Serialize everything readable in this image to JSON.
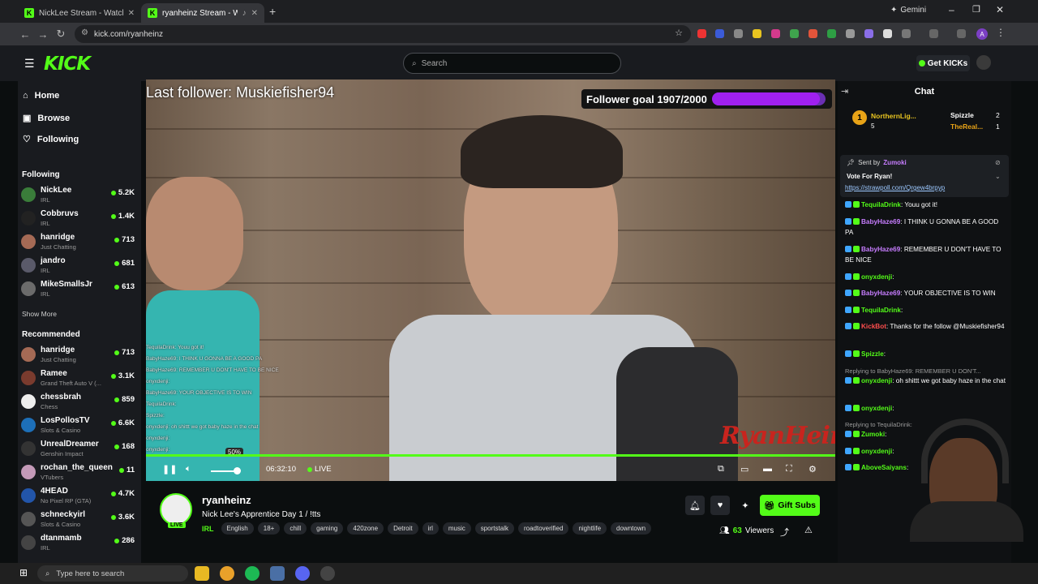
{
  "browser": {
    "tabs": [
      {
        "title": "NickLee Stream - Watch Live on",
        "active": false
      },
      {
        "title": "ryanheinz Stream - Watch L",
        "active": true
      }
    ],
    "url": "kick.com/ryanheinz",
    "gemini_label": "Gemini",
    "profile_initial": "A"
  },
  "topnav": {
    "logo": "KICK",
    "search_placeholder": "Search",
    "get_kicks": "Get KICKs"
  },
  "sidebar": {
    "nav": [
      {
        "label": "Home",
        "icon": "home-icon"
      },
      {
        "label": "Browse",
        "icon": "compass-icon"
      },
      {
        "label": "Following",
        "icon": "heart-icon"
      }
    ],
    "following_title": "Following",
    "following": [
      {
        "name": "NickLee",
        "category": "IRL",
        "viewers": "5.2K",
        "color": "#3a7d3a"
      },
      {
        "name": "Cobbruvs",
        "category": "IRL",
        "viewers": "1.4K",
        "color": "#222"
      },
      {
        "name": "hanridge",
        "category": "Just Chatting",
        "viewers": "713",
        "color": "#a56a55"
      },
      {
        "name": "jandro",
        "category": "IRL",
        "viewers": "681",
        "color": "#5a5a6a"
      },
      {
        "name": "MikeSmallsJr",
        "category": "IRL",
        "viewers": "613",
        "color": "#6b6b6b"
      }
    ],
    "show_more": "Show More",
    "recommended_title": "Recommended",
    "recommended": [
      {
        "name": "hanridge",
        "category": "Just Chatting",
        "viewers": "713",
        "color": "#a56a55"
      },
      {
        "name": "Ramee",
        "category": "Grand Theft Auto V (...",
        "viewers": "3.1K",
        "color": "#7a3b2e"
      },
      {
        "name": "chessbrah",
        "category": "Chess",
        "viewers": "859",
        "color": "#eee"
      },
      {
        "name": "LosPollosTV",
        "category": "Slots & Casino",
        "viewers": "6.6K",
        "color": "#1d6fb8"
      },
      {
        "name": "UnrealDreamer",
        "category": "Genshin Impact",
        "viewers": "168",
        "color": "#333"
      },
      {
        "name": "rochan_the_queen",
        "category": "VTubers",
        "viewers": "11",
        "color": "#c49ab8"
      },
      {
        "name": "4HEAD",
        "category": "No Pixel RP (GTA)",
        "viewers": "4.7K",
        "color": "#2255aa"
      },
      {
        "name": "schneckyirl",
        "category": "Slots & Casino",
        "viewers": "3.6K",
        "color": "#555"
      },
      {
        "name": "dtanmamb",
        "category": "IRL",
        "viewers": "286",
        "color": "#444"
      }
    ]
  },
  "video": {
    "last_follower": "Last follower: Muskiefisher94",
    "follower_goal_label": "Follower goal 1907/2000",
    "follower_goal_fraction": 0.9535,
    "overlay_chat": [
      "TequilaDrink: Youu got it!",
      "BabyHaze69: I THINK U GONNA BE A GOOD PA",
      "BabyHaze69: REMEMBER U DON'T HAVE TO BE NICE",
      "onyxdenji:",
      "BabyHaze69: YOUR OBJECTIVE IS TO WIN",
      "TequilaDrink:",
      "Spizzle:",
      "onyxdenji: oh shittt we got baby haze in the chat",
      "onyxdenji:",
      "onyxdenji:"
    ],
    "volume_tooltip": "50%",
    "volume_fraction": 0.5,
    "time": "06:32:10",
    "live_label": "LIVE",
    "watermark": "RyanHeinz"
  },
  "stream": {
    "streamer": "ryanheinz",
    "title": "Nick Lee's Apprentice Day 1 / !tts",
    "live_badge": "LIVE",
    "category": "IRL",
    "tags": [
      "English",
      "18+",
      "chill",
      "gaming",
      "420zone",
      "Detroit",
      "irl",
      "music",
      "sportstalk",
      "roadtoverified",
      "nightlife",
      "downtown"
    ],
    "gift_subs": "Gift Subs",
    "viewers_count": "63",
    "viewers_label": "Viewers"
  },
  "chat": {
    "title": "Chat",
    "top_gifters": [
      {
        "rank": "1",
        "name": "NorthernLig...",
        "count": "5"
      },
      {
        "rank": "",
        "name": "Spizzle",
        "count": "2"
      },
      {
        "rank": "",
        "name": "TheReal...",
        "count": "1"
      }
    ],
    "pinned": {
      "sent_by_label": "Sent by",
      "sender": "Zumoki",
      "message": "Vote For Ryan!",
      "link": "https://strawpoll.com/Qrgew4brpyp"
    },
    "messages": [
      {
        "user": "TequilaDrink",
        "color": "#53fc18",
        "text": "Youu got it!",
        "reply": ""
      },
      {
        "user": "BabyHaze69",
        "color": "#c77dff",
        "text": "I THINK U GONNA BE A GOOD PA",
        "reply": ""
      },
      {
        "user": "BabyHaze69",
        "color": "#c77dff",
        "text": "REMEMBER U DON'T HAVE TO BE NICE",
        "reply": ""
      },
      {
        "user": "onyxdenji",
        "color": "#53fc18",
        "text": "",
        "reply": ""
      },
      {
        "user": "BabyHaze69",
        "color": "#c77dff",
        "text": "YOUR OBJECTIVE IS TO WIN",
        "reply": ""
      },
      {
        "user": "TequilaDrink",
        "color": "#53fc18",
        "text": "",
        "reply": ""
      },
      {
        "user": "KickBot",
        "color": "#ff4d4d",
        "text": "Thanks for the follow @Muskiefisher94",
        "reply": ""
      },
      {
        "user": "Spizzle",
        "color": "#53fc18",
        "text": "",
        "reply": ""
      },
      {
        "user": "onyxdenji",
        "color": "#53fc18",
        "text": "oh shittt we got baby haze in the chat",
        "reply": "Replying to BabyHaze69: REMEMBER U DON'T..."
      },
      {
        "user": "onyxdenji",
        "color": "#53fc18",
        "text": "",
        "reply": ""
      },
      {
        "user": "Zumoki",
        "color": "#53fc18",
        "text": "",
        "reply": "Replying to TequilaDrink:"
      },
      {
        "user": "onyxdenji",
        "color": "#53fc18",
        "text": "",
        "reply": ""
      },
      {
        "user": "AboveSaiyans",
        "color": "#53fc18",
        "text": "",
        "reply": ""
      }
    ]
  },
  "taskbar": {
    "search_placeholder": "Type here to search"
  },
  "colors": {
    "kick_green": "#53fc18",
    "goal_purple": "#a020f0",
    "background": "#0b0e0f",
    "panel": "#191b1f"
  }
}
